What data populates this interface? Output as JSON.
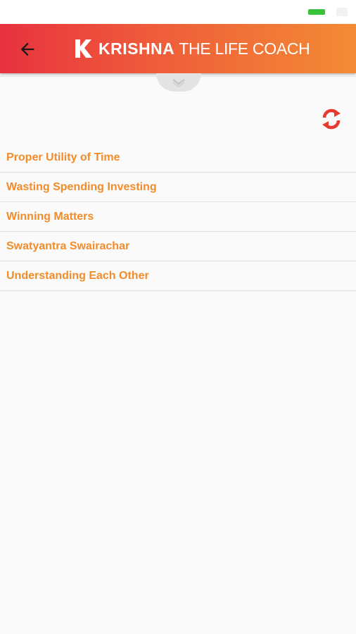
{
  "status_bar": {
    "time": "",
    "battery_color": "#39c23a"
  },
  "app_bar": {
    "back_icon": "arrow-left-icon",
    "logo": {
      "mark": "K",
      "brand": "KRISHNA",
      "tagline": "THE LIFE COACH"
    },
    "gradient_colors": [
      "#e8323f",
      "#f38b35"
    ]
  },
  "pull_tab": {
    "icon": "chevron-down-icon"
  },
  "section": {
    "title": "",
    "refresh_icon": "refresh-icon",
    "refresh_color": "#e63b2e"
  },
  "topics": [
    {
      "label": "Proper Utility of Time"
    },
    {
      "label": "Wasting Spending Investing"
    },
    {
      "label": "Winning Matters"
    },
    {
      "label": "Swatyantra Swairachar"
    },
    {
      "label": "Understanding Each Other"
    }
  ],
  "colors": {
    "accent": "#f28c2a",
    "background": "#fafafa",
    "divider": "#e1e1e1"
  }
}
